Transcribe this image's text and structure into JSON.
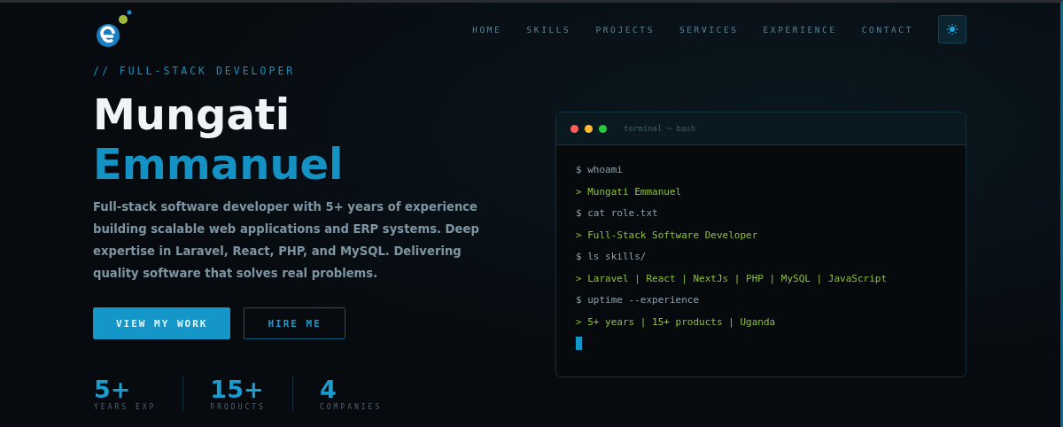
{
  "nav": {
    "items": [
      {
        "label": "HOME"
      },
      {
        "label": "SKILLS"
      },
      {
        "label": "PROJECTS"
      },
      {
        "label": "SERVICES"
      },
      {
        "label": "EXPERIENCE"
      },
      {
        "label": "CONTACT"
      }
    ]
  },
  "hero": {
    "eyebrow": "// FULL-STACK DEVELOPER",
    "name_first": "Mungati",
    "name_last": "Emmanuel",
    "description": "Full-stack software developer with 5+ years of experience building scalable web applications and ERP systems. Deep expertise in Laravel, React, PHP, and MySQL. Delivering quality software that solves real problems.",
    "buttons": [
      {
        "label": "VIEW MY WORK",
        "kind": "primary"
      },
      {
        "label": "HIRE ME",
        "kind": "outline"
      }
    ],
    "stats": [
      {
        "value": "5+",
        "label": "YEARS EXP"
      },
      {
        "value": "15+",
        "label": "PRODUCTS"
      },
      {
        "value": "4",
        "label": "COMPANIES"
      }
    ]
  },
  "terminal": {
    "title": "terminal ~ bash",
    "lines": [
      {
        "kind": "command",
        "prompt": "$",
        "text": "whoami"
      },
      {
        "kind": "output",
        "prompt": ">",
        "text": "Mungati Emmanuel"
      },
      {
        "kind": "command",
        "prompt": "$",
        "text": "cat role.txt"
      },
      {
        "kind": "output",
        "prompt": ">",
        "text": "Full-Stack Software Developer"
      },
      {
        "kind": "command",
        "prompt": "$",
        "text": "ls skills/"
      },
      {
        "kind": "output",
        "prompt": ">",
        "text": "Laravel | React | NextJs | PHP | MySQL | JavaScript"
      },
      {
        "kind": "command",
        "prompt": "$",
        "text": "uptime --experience"
      },
      {
        "kind": "output",
        "prompt": ">",
        "text": "5+ years | 15+ products | Uganda"
      },
      {
        "kind": "cursor"
      }
    ]
  }
}
